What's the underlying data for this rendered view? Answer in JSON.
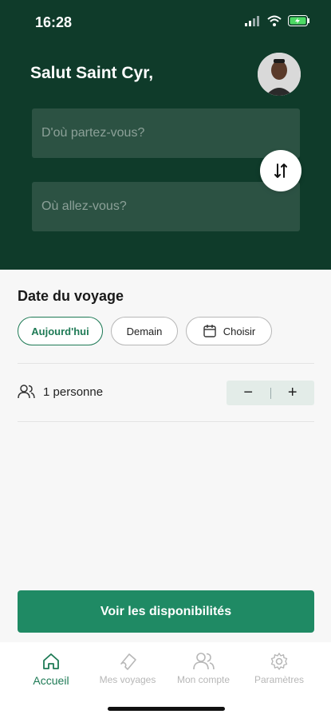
{
  "status_bar": {
    "time": "16:28"
  },
  "header": {
    "greeting": "Salut Saint Cyr,",
    "from_placeholder": "D'où partez-vous?",
    "to_placeholder": "Où allez-vous?"
  },
  "date_section": {
    "title": "Date du voyage",
    "chips": [
      "Aujourd'hui",
      "Demain",
      "Choisir"
    ],
    "selected": "Aujourd'hui"
  },
  "passengers": {
    "label": "1 personne",
    "minus": "−",
    "plus": "+"
  },
  "cta": {
    "label": "Voir les disponibilités"
  },
  "tabbar": {
    "items": [
      {
        "label": "Accueil",
        "icon": "home-icon",
        "active": true
      },
      {
        "label": "Mes voyages",
        "icon": "ticket-icon",
        "active": false
      },
      {
        "label": "Mon compte",
        "icon": "users-icon",
        "active": false
      },
      {
        "label": "Paramètres",
        "icon": "gear-icon",
        "active": false
      }
    ]
  },
  "colors": {
    "header_bg": "#0f3b2a",
    "accent": "#1f8a64",
    "accent_text": "#1e7a55"
  }
}
